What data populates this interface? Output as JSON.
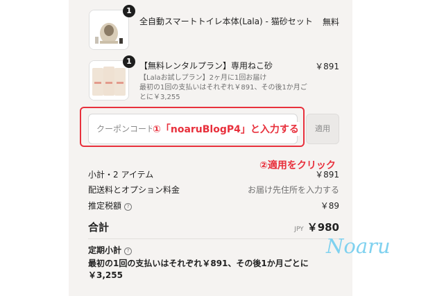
{
  "items": [
    {
      "name": "全自動スマートトイレ本体(Lala) - 猫砂セット",
      "price": "無料",
      "qty": "1",
      "sub1": "",
      "sub2": ""
    },
    {
      "name": "【無料レンタルプラン】専用ねこ砂",
      "price": "￥891",
      "qty": "1",
      "sub1": "【Lalaお試しプラン】2ヶ月に1回お届け",
      "sub2": "最初の1回の支払いはそれぞれ￥891、その後1か月ごとに￥3,255"
    }
  ],
  "coupon": {
    "placeholder": "クーポンコード",
    "apply_label": "適用"
  },
  "annotations": {
    "step1": "①「noaruBlogP4」と入力する",
    "step2": "②適用をクリック",
    "watermark": "Noaru"
  },
  "summary": {
    "subtotal_label": "小計・2 アイテム",
    "subtotal_value": "￥891",
    "shipping_label": "配送料とオプション料金",
    "shipping_value": "お届け先住所を入力する",
    "tax_label": "推定税額",
    "tax_value": "￥89",
    "total_label": "合計",
    "currency": "JPY",
    "total_value": "￥980",
    "recurring_label": "定期小計",
    "recurring_text": "最初の1回の支払いはそれぞれ￥891、その後1か月ごとに￥3,255"
  },
  "colors": {
    "annotation": "#e8303c",
    "watermark": "#7fd1ef",
    "panel": "#f5f3f1"
  }
}
